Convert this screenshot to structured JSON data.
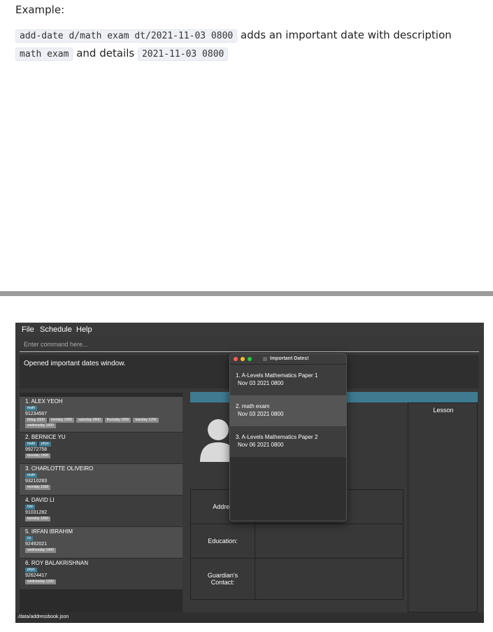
{
  "doc": {
    "heading": "Example:",
    "command_code": "add-date d/math exam dt/2021-11-03 0800",
    "text_after_command": " adds an important date with description ",
    "description_code": "math exam",
    "text_and_details": " and details ",
    "details_code": "2021-11-03 0800"
  },
  "app": {
    "menu": [
      "File",
      "Schedule",
      "Help"
    ],
    "command_placeholder": "Enter command here...",
    "result_message": "Opened important dates window.",
    "status_path": "./data/addressbook.json",
    "persons": [
      {
        "name": "1.  ALEX YEOH",
        "tags": [
          "math"
        ],
        "phone": "91234567",
        "lessons": [
          "friday 2000",
          "monday 2000",
          "saturday 0800",
          "thursday 1800",
          "tuesday 1200"
        ],
        "lessons_row2": [
          "wednesday 1600"
        ]
      },
      {
        "name": "2.  BERNICE YU",
        "tags": [
          "math",
          "phys"
        ],
        "phone": "99272758",
        "lessons": [
          "monday 1800"
        ],
        "lessons_row2": []
      },
      {
        "name": "3.  CHARLOTTE OLIVEIRO",
        "tags": [
          "math"
        ],
        "phone": "93210283",
        "lessons": [
          "monday 1500"
        ],
        "lessons_row2": []
      },
      {
        "name": "4.  DAVID LI",
        "tags": [
          "hist"
        ],
        "phone": "91031282",
        "lessons": [
          "tuesday 1000"
        ],
        "lessons_row2": []
      },
      {
        "name": "5.  IRFAN IBRAHIM",
        "tags": [
          "cs"
        ],
        "phone": "92492021",
        "lessons": [
          "wednesday 1400"
        ],
        "lessons_row2": []
      },
      {
        "name": "6.  ROY BALAKRISHNAN",
        "tags": [
          "phys"
        ],
        "phone": "92624417",
        "lessons": [
          "wednesday 1200"
        ],
        "lessons_row2": []
      }
    ],
    "detail": {
      "address_label": "Addres",
      "education_label": "Education:",
      "guardian_label": "Guardian's\nContact:",
      "lesson_header": "Lesson"
    }
  },
  "popup": {
    "title": "Important Dates!",
    "dates": [
      {
        "line1": "1.  A-Levels Mathematics Paper 1",
        "line2": "Nov 03 2021 0800"
      },
      {
        "line1": "2.  math exam",
        "line2": "Nov 03 2021 0800"
      },
      {
        "line1": "3.  A-Levels Mathematics Paper 2",
        "line2": "Nov 06 2021 0800"
      }
    ]
  },
  "colors": {
    "tag": "#3e7b91",
    "teal_bar": "#3e7b91",
    "window_bg": "#383838"
  }
}
